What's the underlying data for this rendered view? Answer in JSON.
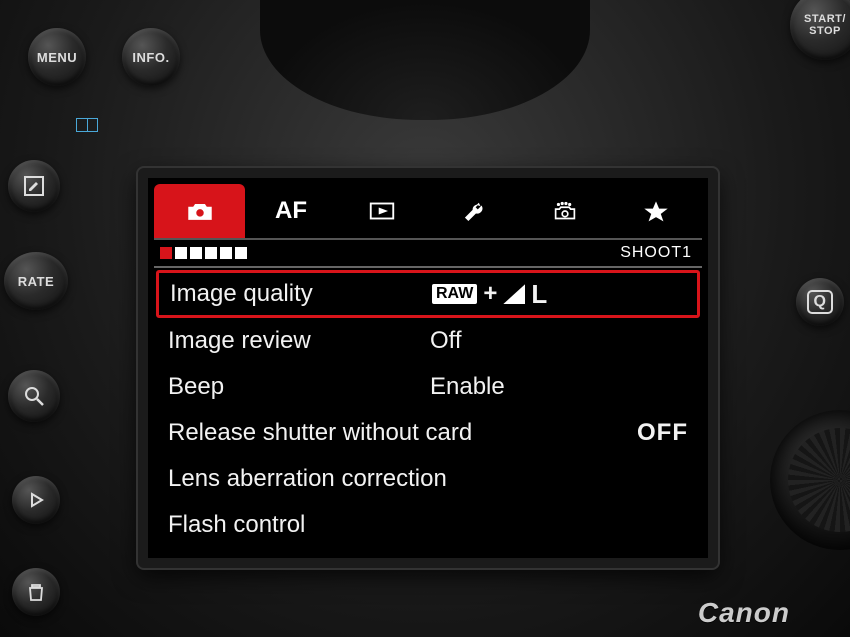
{
  "physical": {
    "menu": "MENU",
    "info": "INFO.",
    "rate": "RATE",
    "q": "Q",
    "start_stop": "START/\nSTOP"
  },
  "brand": "Canon",
  "screen": {
    "tabs": [
      {
        "id": "shoot",
        "icon": "camera",
        "active": true
      },
      {
        "id": "af",
        "label": "AF"
      },
      {
        "id": "playback",
        "icon": "play-rect"
      },
      {
        "id": "setup",
        "icon": "wrench"
      },
      {
        "id": "custom",
        "icon": "camera-dots"
      },
      {
        "id": "mymenu",
        "icon": "star"
      }
    ],
    "sub_page_count": 6,
    "sub_page_active": 0,
    "sub_label": "SHOOT1",
    "rows": [
      {
        "label": "Image quality",
        "value_type": "rawplus",
        "value_raw": "RAW",
        "value_size": "L",
        "active": true
      },
      {
        "label": "Image review",
        "value": "Off"
      },
      {
        "label": "Beep",
        "value": "Enable"
      },
      {
        "label": "Release shutter without card",
        "value": "OFF",
        "align": "right"
      },
      {
        "label": "Lens aberration correction"
      },
      {
        "label": "Flash control"
      }
    ]
  }
}
